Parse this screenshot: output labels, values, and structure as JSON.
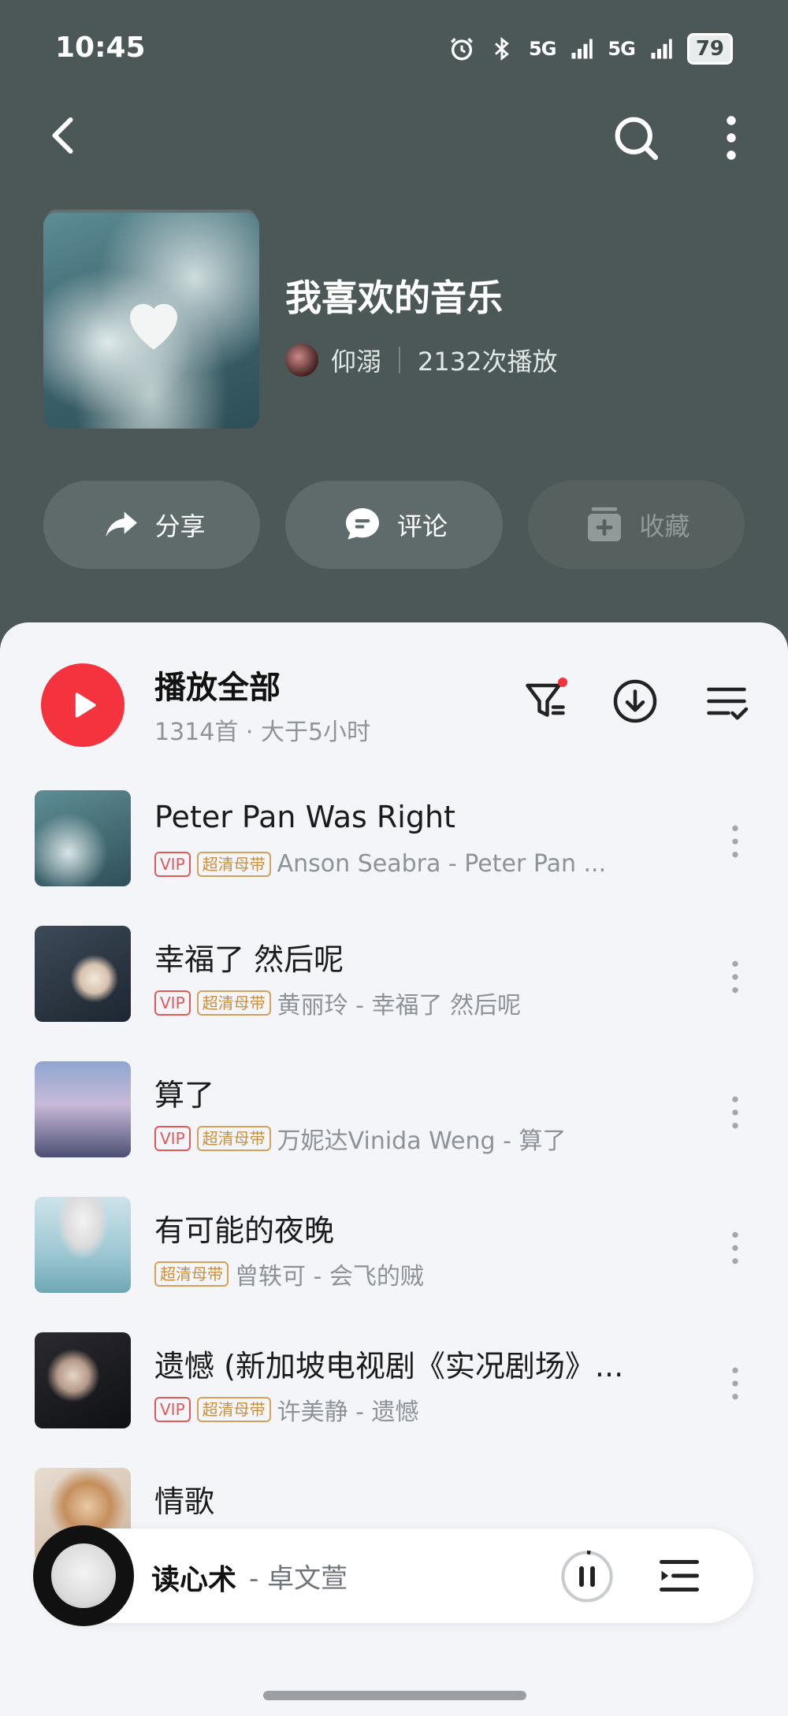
{
  "status_bar": {
    "time": "10:45",
    "battery": "79",
    "signal_1": "5G",
    "signal_2": "5G"
  },
  "nav": {
    "back_icon": "back-arrow-icon",
    "search_icon": "search-icon",
    "more_icon": "more-vertical-icon"
  },
  "playlist": {
    "title": "我喜欢的音乐",
    "creator": "仰溺",
    "play_count": "2132次播放"
  },
  "actions": {
    "share": "分享",
    "comment": "评论",
    "collect": "收藏"
  },
  "play_all": {
    "label": "播放全部",
    "meta": "1314首 · 大于5小时"
  },
  "songs": [
    {
      "title": "Peter Pan Was Right",
      "vip": "VIP",
      "quality": "超清母带",
      "artist": "Anson Seabra - Peter Pan ..."
    },
    {
      "title": "幸福了 然后呢",
      "vip": "VIP",
      "quality": "超清母带",
      "artist": "黄丽玲 - 幸福了 然后呢"
    },
    {
      "title": "算了",
      "vip": "VIP",
      "quality": "超清母带",
      "artist": "万妮达Vinida Weng - 算了"
    },
    {
      "title": "有可能的夜晚",
      "vip": "",
      "quality": "超清母带",
      "artist": "曾轶可 - 会飞的贼"
    },
    {
      "title": "遗憾 (新加坡电视剧《实况剧场》...",
      "vip": "VIP",
      "quality": "超清母带",
      "artist": "许美静 - 遗憾"
    },
    {
      "title": "情歌",
      "vip": "",
      "quality": "",
      "artist": ""
    }
  ],
  "mini_player": {
    "title": "读心术",
    "artist": "- 卓文萱"
  },
  "colors": {
    "header_bg": "#4b5857",
    "accent_red": "#f5333f",
    "sheet_bg": "#f4f5f9"
  }
}
